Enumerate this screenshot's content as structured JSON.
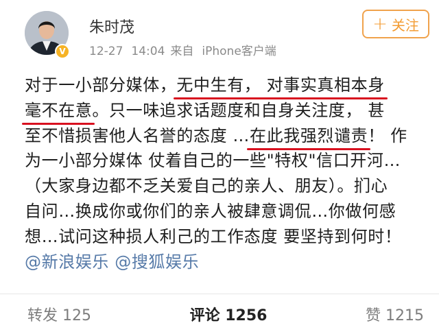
{
  "post": {
    "username": "朱时茂",
    "date": "12-27",
    "time": "14:04",
    "source_prefix": "来自",
    "source_app": "iPhone客户端",
    "follow_label": "关注",
    "verified_icon": "verified-badge-icon",
    "content": {
      "line1_a": "对于一小部分媒体，",
      "line1_b": "无中生有，  对事实真相本身",
      "line2_a": "毫不在意",
      "line2_b": "。只一味追求话题度和自身关注度，  甚",
      "line3_a": "至不惜损害他人名誉的态度 …",
      "line3_b": "在此我强烈谴责",
      "line3_c": "！ 作",
      "line4": "为一小部分媒体 仗着自己的一些\"特权\"信口开河…",
      "line5": "（大家身边都不乏关爱自己的亲人、朋友）。扪心",
      "line6": "自问…换成你或你们的亲人被肆意调侃…你做何感",
      "line7": "想…试问这种损人利己的工作态度 要坚持到何时！",
      "mention1": "@新浪娱乐",
      "mention2": "@搜狐娱乐"
    },
    "actions": {
      "repost": "转发 125",
      "comment": "评论 1256",
      "like": "赞 1215"
    }
  },
  "colors": {
    "accent": "#f39c33",
    "highlight_underline": "#d8101f",
    "mention": "#567aa8"
  }
}
